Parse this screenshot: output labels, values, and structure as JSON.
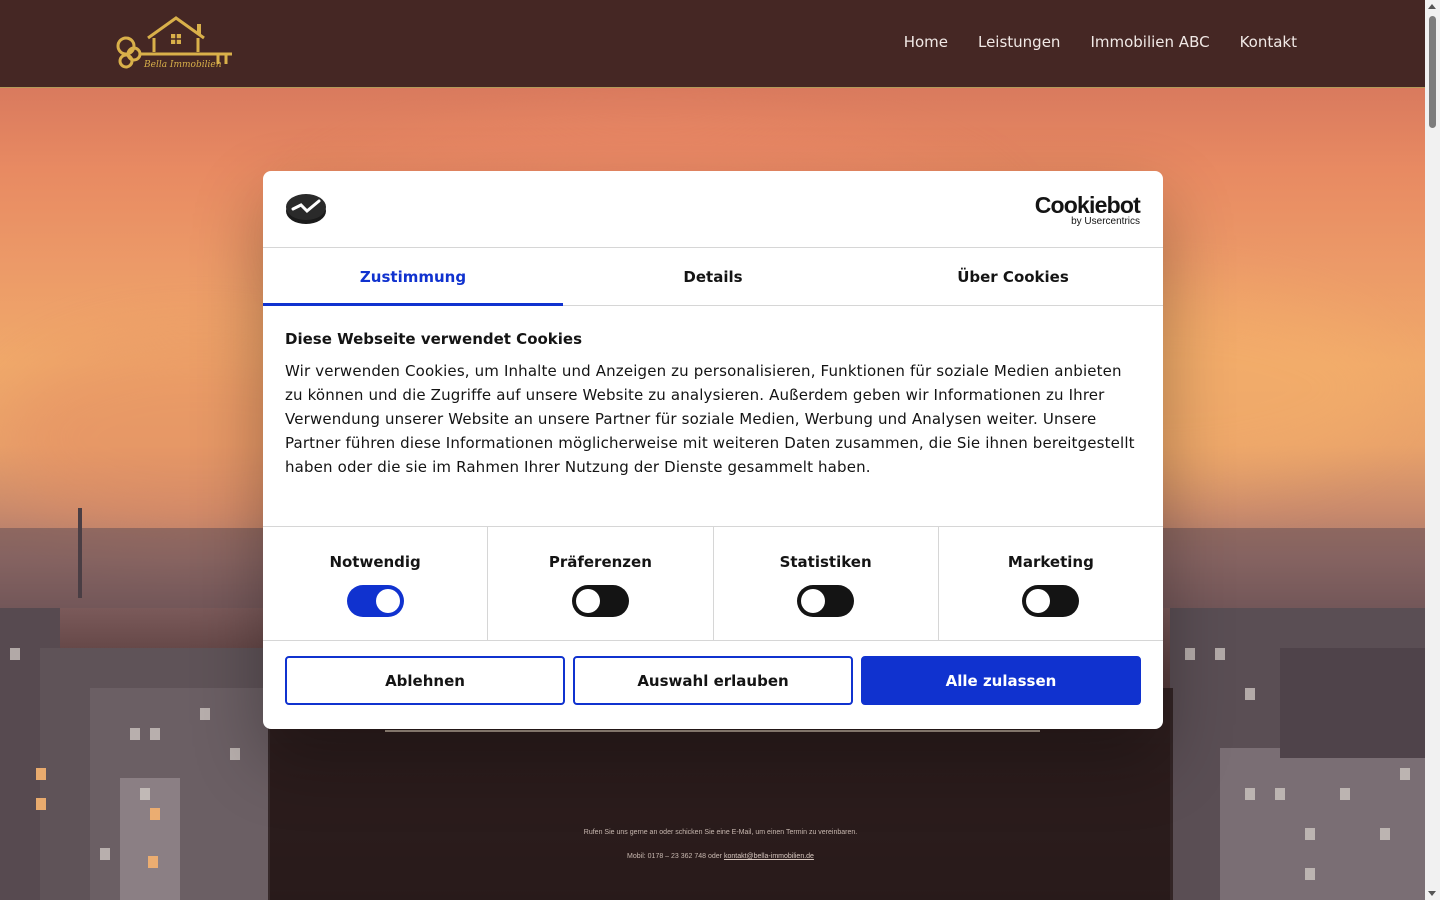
{
  "header": {
    "logo_text": "Bella Immobilien",
    "nav": [
      "Home",
      "Leistungen",
      "Immobilien ABC",
      "Kontakt"
    ]
  },
  "cookie_dialog": {
    "brand_name": "Cookiebot",
    "brand_sub": "by Usercentrics",
    "tabs": [
      {
        "label": "Zustimmung",
        "active": true
      },
      {
        "label": "Details",
        "active": false
      },
      {
        "label": "Über Cookies",
        "active": false
      }
    ],
    "title": "Diese Webseite verwendet Cookies",
    "body": "Wir verwenden Cookies, um Inhalte und Anzeigen zu personalisieren, Funktionen für soziale Medien anbieten zu können und die Zugriffe auf unsere Website zu analysieren. Außerdem geben wir Informationen zu Ihrer Verwendung unserer Website an unsere Partner für soziale Medien, Werbung und Analysen weiter. Unsere Partner führen diese Informationen möglicherweise mit weiteren Daten zusammen, die Sie ihnen bereitgestellt haben oder die sie im Rahmen Ihrer Nutzung der Dienste gesammelt haben.",
    "toggles": [
      {
        "label": "Notwendig",
        "on": true
      },
      {
        "label": "Präferenzen",
        "on": false
      },
      {
        "label": "Statistiken",
        "on": false
      },
      {
        "label": "Marketing",
        "on": false
      }
    ],
    "buttons": {
      "decline": "Ablehnen",
      "allow_selection": "Auswahl erlauben",
      "allow_all": "Alle zulassen"
    }
  },
  "footer": {
    "line1": "Rufen Sie uns gerne an oder schicken Sie eine E-Mail, um einen Termin zu vereinbaren.",
    "phone": "Mobil: 0178 – 23 362 748 oder",
    "email": "kontakt@bella-immobilien.de"
  },
  "colors": {
    "header_bg": "#452724",
    "accent": "#1032cf",
    "logo_gold": "#d9b04a"
  }
}
